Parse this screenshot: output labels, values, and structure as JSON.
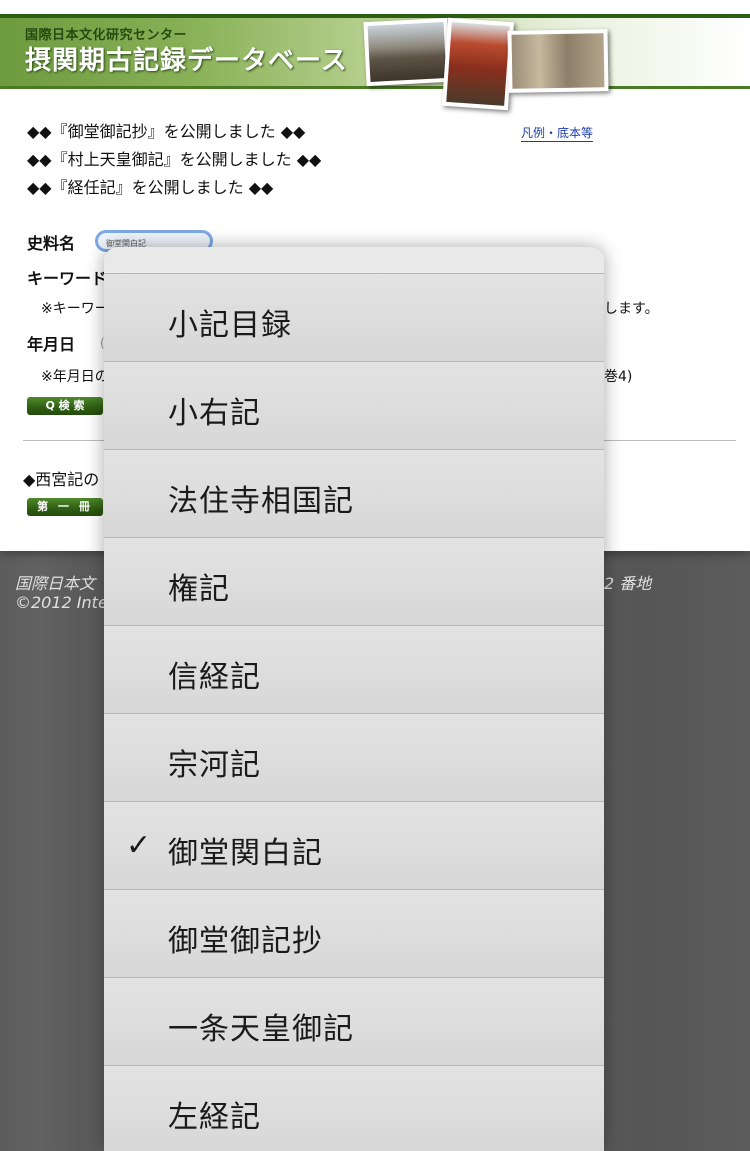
{
  "header": {
    "org_name": "国際日本文化研究センター",
    "db_title": "摂関期古記録データベース"
  },
  "notices": [
    "◆◆『御堂御記抄』を公開しました ◆◆",
    "◆◆『村上天皇御記』を公開しました ◆◆",
    "◆◆『経任記』を公開しました ◆◆"
  ],
  "legend_link": "凡例・底本等",
  "form": {
    "source_label": "史料名",
    "source_value": "御堂関白記",
    "keyword_label": "キーワード",
    "keyword_note": "※キーワー",
    "keyword_note_right": "します。",
    "date_label": "年月日",
    "date_hint": "(",
    "date_note": "※年月日の",
    "date_note_right": "巻4)",
    "search_button": "Q 検 索"
  },
  "section": {
    "title": "◆西宮記の",
    "volume_button": "第 一 冊"
  },
  "footer": {
    "line1": "国際日本文",
    "line1_right": "2 番地",
    "line2": "©2012 Inter"
  },
  "picker": {
    "selected_index": 6,
    "check_glyph": "✓",
    "options": [
      "小記目録",
      "小右記",
      "法住寺相国記",
      "権記",
      "信経記",
      "宗河記",
      "御堂関白記",
      "御堂御記抄",
      "一条天皇御記",
      "左経記"
    ]
  }
}
